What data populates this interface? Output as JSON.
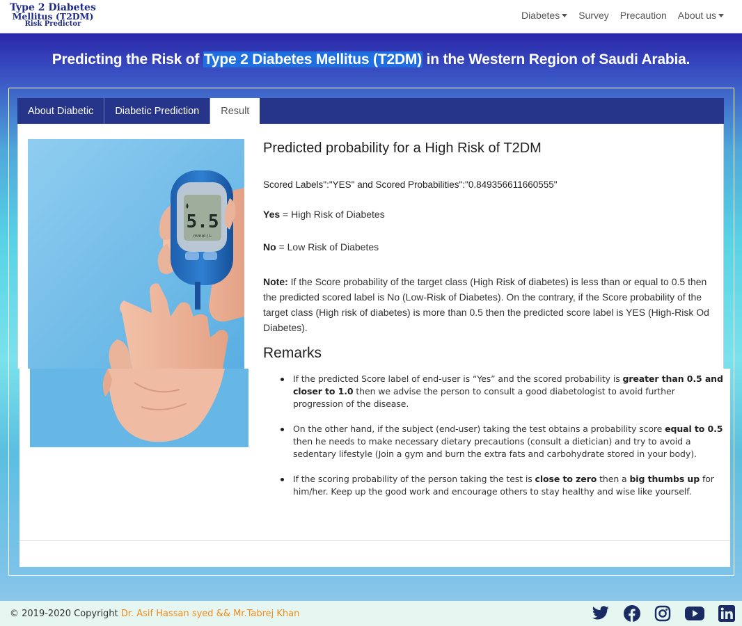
{
  "logo": {
    "line1": "Type 2 Diabetes",
    "line2": "Mellitus (T2DM)",
    "line3": "Risk Predictor"
  },
  "nav": {
    "diabetes": "Diabetes",
    "survey": "Survey",
    "precaution": "Precaution",
    "about": "About us"
  },
  "hero": {
    "title_pre": "Predicting the Risk of ",
    "title_highlight": "Type 2 Diabetes Mellitus (T2DM)",
    "title_post": " in the Western Region of Saudi Arabia."
  },
  "tabs": {
    "about": "About Diabetic",
    "prediction": "Diabetic Prediction",
    "result": "Result"
  },
  "result": {
    "heading": "Predicted probability for a High Risk of T2DM",
    "scored_line": "Scored Labels\":\"YES\" and Scored Probabilities\":\"0.849356611660555\"",
    "yes_label": "Yes",
    "yes_text": " = High Risk of Diabetes",
    "no_label": "No",
    "no_text": " = Low Risk of Diabetes",
    "note_label": "Note:",
    "note_text": " If the Score probability of the target class (High Risk of diabetes) is less than or equal to 0.5 then the predicted scored label is No (Low-Risk of Diabetes). On the contrary, if the Score probability of the target class (High risk of diabetes) is more than 0.5 then the predicted score label is YES (High-Risk Od Diabetes).",
    "remarks_heading": "Remarks"
  },
  "remarks": {
    "r1_a": "If the predicted Score label of end-user is “Yes” and the scored probability is ",
    "r1_b": "greater than 0.5 and closer to 1.0",
    "r1_c": " then we advise the person to consult a good diabetologist to avoid further progression of the disease.",
    "r2_a": "On the other hand, if the subject (end-user) taking the test obtains a probability score ",
    "r2_b": "equal to 0.5",
    "r2_c": " then he needs to make necessary dietary precautions (consult a dietician) and try to avoid a sedentary lifestyle (Join a gym and burn the extra fats and carbohydrate stored in your body).",
    "r3_a": "If the scoring probability of the person taking the test is ",
    "r3_b": "close to zero",
    "r3_c": " then a ",
    "r3_d": "big thumbs up",
    "r3_e": " for him/her. Keep up the good work and encourage others to stay healthy and wise like yourself."
  },
  "glucometer": {
    "reading": "5.5",
    "unit": "mmol / L"
  },
  "footer": {
    "copyright": "© 2019-2020 Copyright ",
    "authors": "Dr. Asif Hassan syed && Mr.Tabrej Khan"
  },
  "icons": {
    "twitter": "twitter-icon",
    "facebook": "facebook-icon",
    "instagram": "instagram-icon",
    "youtube": "youtube-icon",
    "linkedin": "linkedin-icon"
  },
  "colors": {
    "navy": "#263489",
    "logo": "#1c2a8a",
    "author_link": "#f08a1c",
    "highlight": "#1f6fe0"
  }
}
